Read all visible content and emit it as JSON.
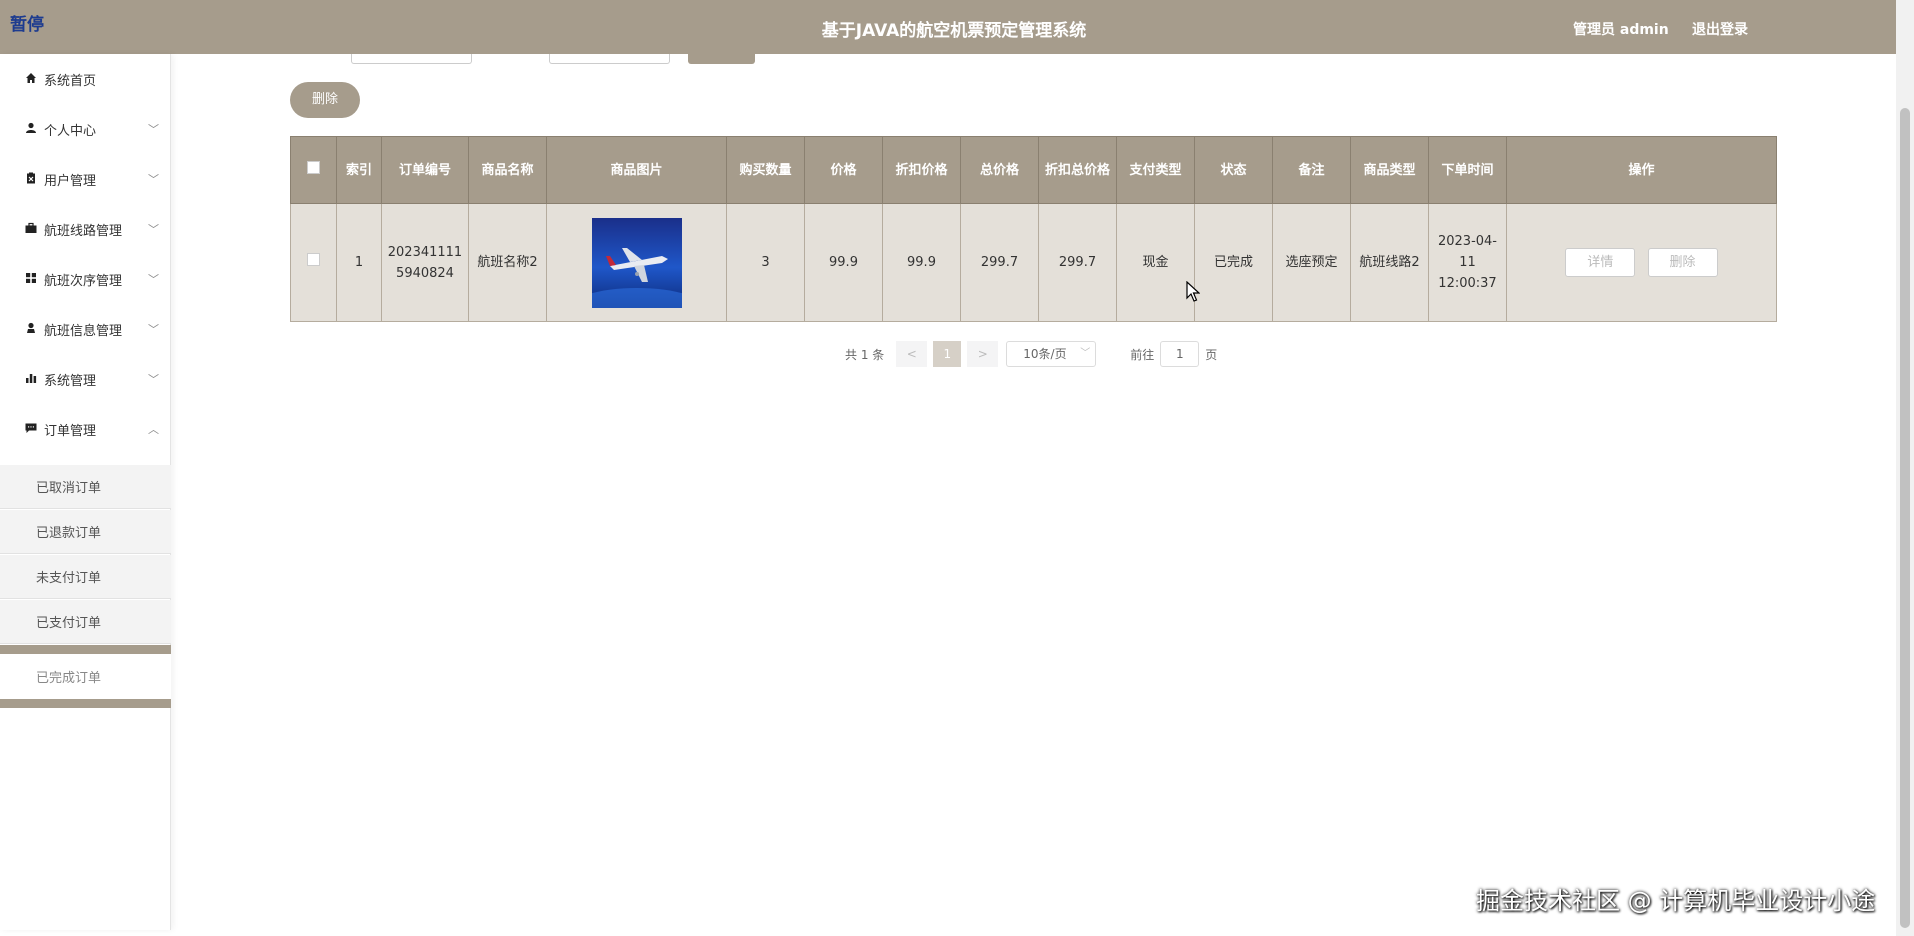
{
  "header": {
    "logo_text": "暂停",
    "title": "基于JAVA的航空机票预定管理系统",
    "user": "管理员 admin",
    "logout": "退出登录"
  },
  "sidebar": {
    "items": [
      {
        "label": "系统首页",
        "icon": "home-icon"
      },
      {
        "label": "个人中心",
        "icon": "person-icon"
      },
      {
        "label": "用户管理",
        "icon": "clipboard-icon"
      },
      {
        "label": "航班线路管理",
        "icon": "briefcase-icon"
      },
      {
        "label": "航班次序管理",
        "icon": "grid-icon"
      },
      {
        "label": "航班信息管理",
        "icon": "user-icon"
      },
      {
        "label": "系统管理",
        "icon": "bar-chart-icon"
      },
      {
        "label": "订单管理",
        "icon": "message-icon"
      }
    ],
    "sub_items": [
      {
        "label": "已取消订单"
      },
      {
        "label": "已退款订单"
      },
      {
        "label": "未支付订单"
      },
      {
        "label": "已支付订单"
      },
      {
        "label": "已完成订单"
      }
    ]
  },
  "toolbar": {
    "delete_label": "删除"
  },
  "table": {
    "headers": [
      "索引",
      "订单编号",
      "商品名称",
      "商品图片",
      "购买数量",
      "价格",
      "折扣价格",
      "总价格",
      "折扣总价格",
      "支付类型",
      "状态",
      "备注",
      "商品类型",
      "下单时间",
      "操作"
    ],
    "rows": [
      {
        "index": "1",
        "order_no": "2023411115940824",
        "product_name": "航班名称2",
        "image": "airplane-image",
        "quantity": "3",
        "price": "99.9",
        "discount_price": "99.9",
        "total_price": "299.7",
        "discount_total": "299.7",
        "pay_type": "现金",
        "status": "已完成",
        "remark": "选座预定",
        "product_type": "航班线路2",
        "order_time": "2023-04-11 12:00:37",
        "detail_label": "详情",
        "delete_label": "删除"
      }
    ]
  },
  "pagination": {
    "total": "共 1 条",
    "prev": "<",
    "current": "1",
    "next": ">",
    "page_size": "10条/页",
    "goto_prefix": "前往",
    "goto_value": "1",
    "goto_suffix": "页"
  },
  "watermark": "掘金技术社区 @ 计算机毕业设计小途",
  "colors": {
    "accent": "#a69c8c",
    "row_bg": "#e4e0d9"
  }
}
